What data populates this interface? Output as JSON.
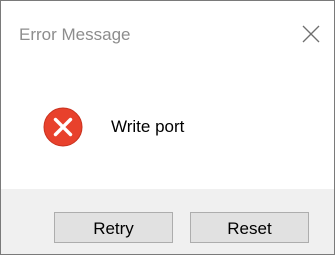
{
  "window": {
    "title": "Error Message",
    "close_icon": "close-icon"
  },
  "message": {
    "icon": "error-icon",
    "icon_color": "#e8412c",
    "text": "Write port"
  },
  "buttons": {
    "retry_label": "Retry",
    "reset_label": "Reset"
  }
}
